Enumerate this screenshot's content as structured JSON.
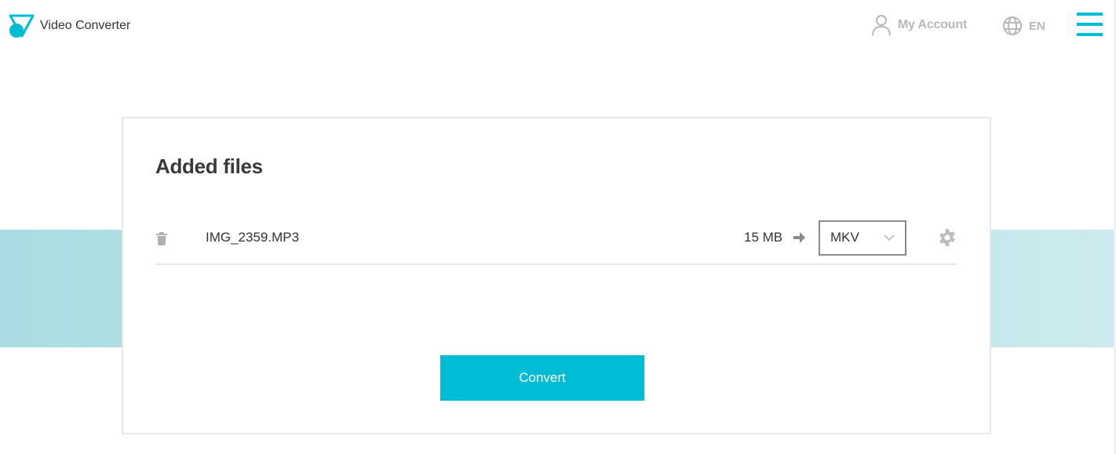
{
  "header": {
    "app_title": "Video Converter",
    "account_label": "My Account",
    "language_label": "EN",
    "logo_icon": "video-converter-logo",
    "account_icon": "user-icon",
    "language_icon": "globe-icon",
    "menu_icon": "hamburger-menu-icon"
  },
  "main": {
    "title": "Added files",
    "files": [
      {
        "name": "IMG_2359.MP3",
        "size": "15 MB",
        "target_format": "MKV"
      }
    ],
    "convert_label": "Convert"
  },
  "colors": {
    "accent": "#00bcd4",
    "band": "#b4e2e7",
    "text": "#333333",
    "muted": "#b8b8b8"
  }
}
